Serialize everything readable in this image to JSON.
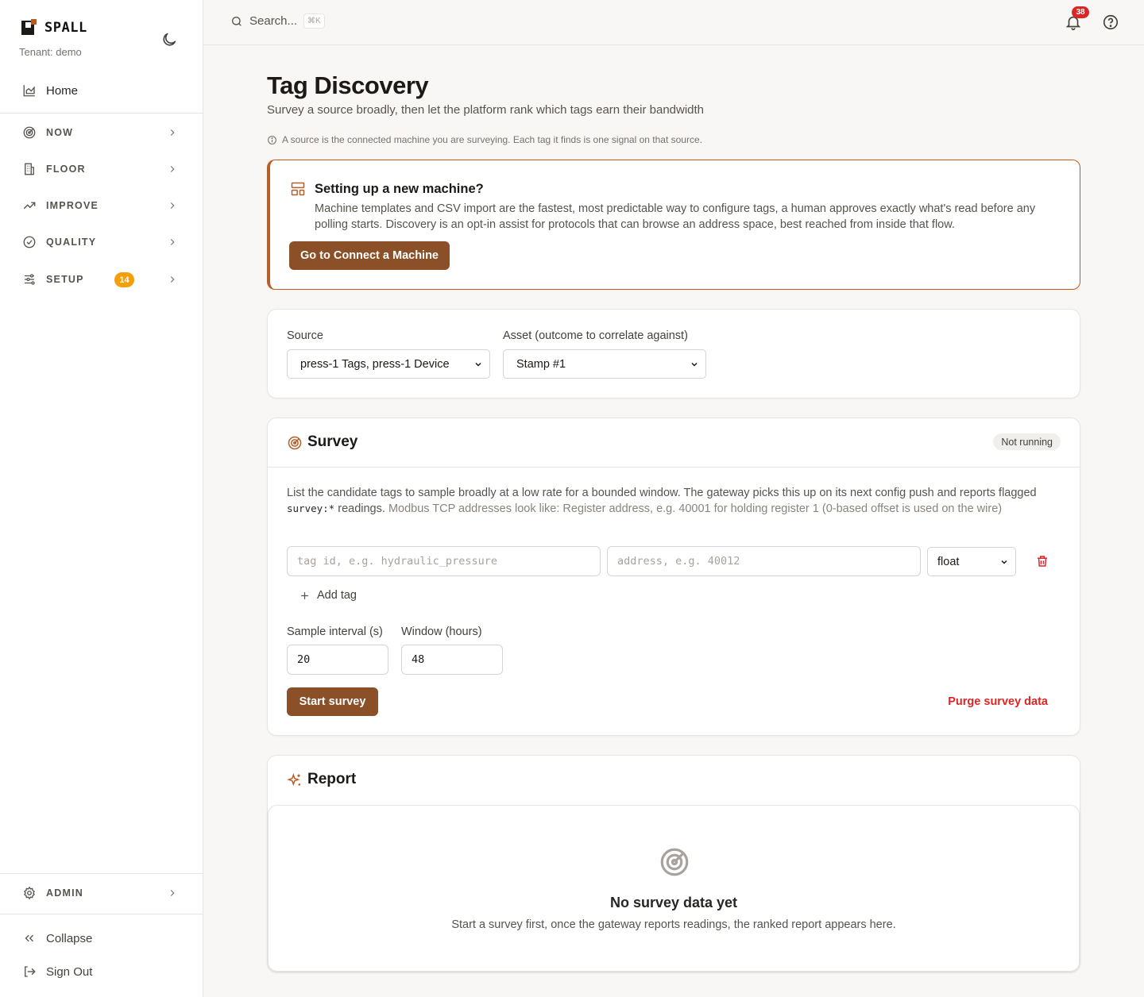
{
  "brand": {
    "name": "SPALL",
    "tenant": "Tenant: demo"
  },
  "sidebar": {
    "home": "Home",
    "groups": [
      {
        "label": "NOW",
        "icon": "radar-icon"
      },
      {
        "label": "FLOOR",
        "icon": "building-icon"
      },
      {
        "label": "IMPROVE",
        "icon": "trend-up-icon"
      },
      {
        "label": "QUALITY",
        "icon": "check-circle-icon"
      },
      {
        "label": "SETUP",
        "icon": "sliders-icon",
        "badge": "14"
      }
    ],
    "admin": "ADMIN",
    "collapse": "Collapse",
    "sign_out": "Sign Out"
  },
  "topbar": {
    "search_placeholder": "Search...",
    "shortcut": "⌘K",
    "notifications_count": "38"
  },
  "page": {
    "title": "Tag Discovery",
    "subtitle": "Survey a source broadly, then let the platform rank which tags earn their bandwidth",
    "note": "A source is the connected machine you are surveying. Each tag it finds is one signal on that source."
  },
  "callout": {
    "title": "Setting up a new machine?",
    "body": "Machine templates and CSV import are the fastest, most predictable way to configure tags, a human approves exactly what's read before any polling starts. Discovery is an opt-in assist for protocols that can browse an address space, best reached from inside that flow.",
    "button": "Go to Connect a Machine"
  },
  "source": {
    "source_label": "Source",
    "source_value": "press-1 Tags, press-1 Device",
    "asset_label": "Asset (outcome to correlate against)",
    "asset_value": "Stamp #1"
  },
  "survey": {
    "title": "Survey",
    "status": "Not running",
    "desc_part1": "List the candidate tags to sample broadly at a low rate for a bounded window. The gateway picks this up on its next config push and reports flagged ",
    "desc_code": "survey:*",
    "desc_part2": " readings. ",
    "desc_muted": "Modbus TCP addresses look like: Register address, e.g. 40001 for holding register 1 (0-based offset is used on the wire)",
    "tag_placeholder": "tag id, e.g. hydraulic_pressure",
    "address_placeholder": "address, e.g. 40012",
    "type_value": "float",
    "add_tag": "Add tag",
    "interval_label": "Sample interval (s)",
    "interval_value": "20",
    "window_label": "Window (hours)",
    "window_value": "48",
    "start_button": "Start survey",
    "purge_button": "Purge survey data"
  },
  "report": {
    "title": "Report",
    "empty_title": "No survey data yet",
    "empty_sub": "Start a survey first, once the gateway reports readings, the ranked report appears here."
  },
  "colors": {
    "accent": "#8b5028",
    "callout_border": "#c2571a",
    "danger": "#dc2626",
    "badge": "#f59e0b"
  }
}
